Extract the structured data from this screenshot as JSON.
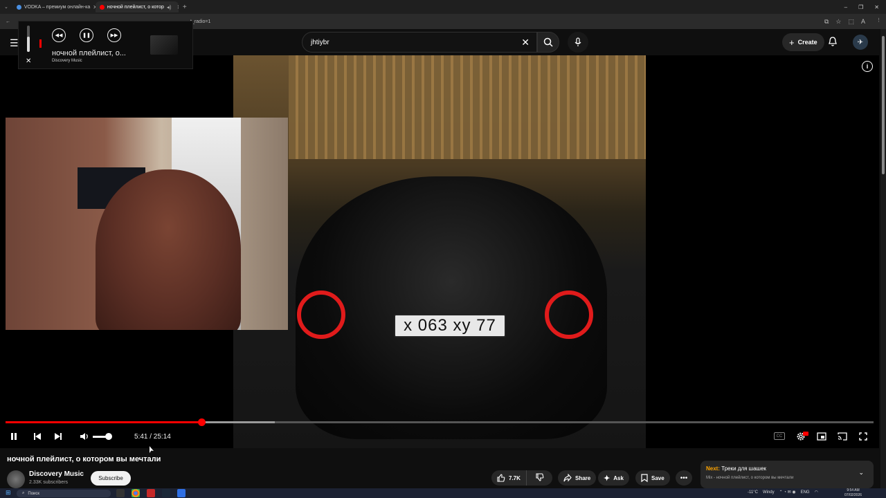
{
  "browser": {
    "tabs": [
      {
        "title": "VODKA – премиум онлайн-ка",
        "active": false
      },
      {
        "title": "ночной плейлист, о котор",
        "active": true
      }
    ],
    "new_tab": "+",
    "url_fragment": "t_radio=1"
  },
  "youtube": {
    "search_value": "jhtiybr",
    "create_label": "Create"
  },
  "miniplayer": {
    "title": "ночной плейлист, о...",
    "artist": "Discovery Music"
  },
  "video_art": {
    "plate_text": "х 063 ху 77"
  },
  "player": {
    "progress_fraction": 0.2258,
    "buffered_fraction": 0.31,
    "time_text": "5:41 / 25:14",
    "volume_fraction": 0.7
  },
  "video": {
    "title": "ночной плейлист, о котором вы мечтали",
    "channel_name": "Discovery Music",
    "subscribers": "2.33K subscribers",
    "subscribe_label": "Subscribe",
    "likes": "7.7K",
    "share_label": "Share",
    "ask_label": "Ask",
    "save_label": "Save"
  },
  "next_card": {
    "prefix": "Next:",
    "title": "Треки для шашек",
    "subtitle": "Mix - ночной плейлист, о котором вы мечтали"
  },
  "taskbar": {
    "search_placeholder": "Поиск",
    "weather": "-11°C",
    "weather_desc": "Windy",
    "lang": "ENG",
    "time": "9:54 AM",
    "date": "07/02/2026"
  },
  "colors": {
    "accent": "#ff0000",
    "background": "#0f0f0f"
  }
}
